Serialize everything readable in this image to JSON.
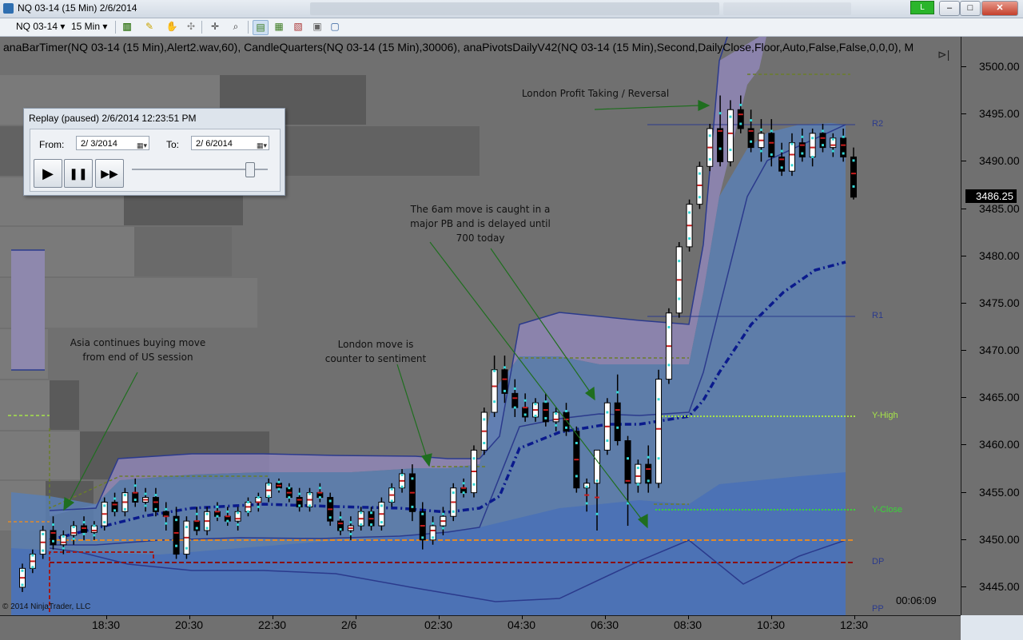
{
  "window": {
    "title": "NQ 03-14 (15 Min)  2/6/2014",
    "live_label": "L",
    "minimize": "–",
    "maximize": "□",
    "close": "✕"
  },
  "toolbar": {
    "instrument": "NQ 03-14",
    "interval": "15 Min"
  },
  "indicators_label": "anaBarTimer(NQ  03-14  (15  Min),Alert2.wav,60),  CandleQuarters(NQ  03-14  (15  Min),30006),  anaPivotsDailyV42(NQ  03-14  (15  Min),Second,DailyClose,Floor,Auto,False,False,0,0,0),  M",
  "replay": {
    "title": "Replay (paused) 2/6/2014 12:23:51 PM",
    "from_label": "From:",
    "from_value": "2/  3/2014",
    "to_label": "To:",
    "to_value": "2/  6/2014",
    "play": "▶",
    "pause": "❚❚",
    "forward": "▶▶",
    "speed_fraction": 0.89
  },
  "annotations": {
    "asia": [
      "Asia continues buying move",
      "from end of US session"
    ],
    "london": [
      "London move is",
      "counter to sentiment"
    ],
    "six_am": [
      "The 6am move is caught in a",
      "major PB and is delayed until",
      "700 today"
    ],
    "profit": [
      "London Profit Taking / Reversal"
    ]
  },
  "pivot_labels": {
    "r2": "R2",
    "r1": "R1",
    "y_high": "Y-High",
    "y_close": "Y-Close",
    "dp": "DP",
    "pp": "PP"
  },
  "colors": {
    "r_level": "#2b3a8c",
    "y_level": "#a6e34a",
    "dp": "#2b3a8c",
    "background": "#707070"
  },
  "current_price": "3486.25",
  "bar_timer": "00:06:09",
  "copyright": "© 2014 NinjaTrader, LLC",
  "chart_data": {
    "type": "candlestick",
    "y_axis": {
      "min": 3443,
      "max": 3501,
      "ticks": [
        "3500.00",
        "3495.00",
        "3490.00",
        "3485.00",
        "3480.00",
        "3475.00",
        "3470.00",
        "3465.00",
        "3460.00",
        "3455.00",
        "3450.00",
        "3445.00"
      ]
    },
    "x_axis": {
      "ticks": [
        "18:30",
        "20:30",
        "22:30",
        "2/6",
        "02:30",
        "04:30",
        "06:30",
        "08:30",
        "10:30",
        "12:30"
      ]
    },
    "levels": {
      "R2": 3494.0,
      "R1": 3473.8,
      "Y-High": 3463.3,
      "Y-Close": 3453.3,
      "DP": 3447.8
    },
    "candles": [
      [
        3445.0,
        3447.5,
        3444.5,
        3447.0
      ],
      [
        3447.0,
        3449.0,
        3446.5,
        3448.5
      ],
      [
        3448.5,
        3451.5,
        3448.0,
        3451.0
      ],
      [
        3451.0,
        3452.5,
        3449.0,
        3449.5
      ],
      [
        3449.5,
        3451.0,
        3448.5,
        3450.5
      ],
      [
        3450.5,
        3452.0,
        3449.5,
        3451.5
      ],
      [
        3451.5,
        3452.5,
        3450.0,
        3450.8
      ],
      [
        3450.8,
        3452.0,
        3450.0,
        3451.5
      ],
      [
        3451.5,
        3454.5,
        3451.0,
        3454.0
      ],
      [
        3454.0,
        3455.0,
        3452.5,
        3453.0
      ],
      [
        3453.0,
        3455.5,
        3452.5,
        3455.0
      ],
      [
        3455.0,
        3456.5,
        3453.5,
        3454.0
      ],
      [
        3454.0,
        3455.5,
        3453.0,
        3454.5
      ],
      [
        3454.5,
        3455.5,
        3452.5,
        3453.0
      ],
      [
        3453.0,
        3454.0,
        3451.0,
        3452.5
      ],
      [
        3452.5,
        3453.5,
        3448.0,
        3448.5
      ],
      [
        3448.5,
        3452.5,
        3448.0,
        3452.0
      ],
      [
        3452.0,
        3453.5,
        3450.5,
        3451.0
      ],
      [
        3451.0,
        3453.5,
        3450.5,
        3453.0
      ],
      [
        3453.0,
        3454.0,
        3452.0,
        3452.5
      ],
      [
        3452.5,
        3453.5,
        3451.5,
        3452.0
      ],
      [
        3452.0,
        3453.5,
        3451.0,
        3453.0
      ],
      [
        3453.0,
        3454.5,
        3452.5,
        3454.0
      ],
      [
        3454.0,
        3455.0,
        3453.0,
        3454.5
      ],
      [
        3454.5,
        3456.5,
        3454.0,
        3456.0
      ],
      [
        3456.0,
        3456.5,
        3455.0,
        3455.5
      ],
      [
        3455.5,
        3456.0,
        3454.0,
        3454.5
      ],
      [
        3454.5,
        3455.5,
        3453.0,
        3453.5
      ],
      [
        3453.5,
        3455.5,
        3453.0,
        3455.0
      ],
      [
        3455.0,
        3456.0,
        3454.0,
        3454.5
      ],
      [
        3454.5,
        3455.0,
        3451.5,
        3452.0
      ],
      [
        3452.0,
        3453.0,
        3450.5,
        3451.0
      ],
      [
        3451.0,
        3452.5,
        3450.0,
        3451.5
      ],
      [
        3451.5,
        3453.5,
        3451.0,
        3453.0
      ],
      [
        3453.0,
        3453.5,
        3451.0,
        3451.5
      ],
      [
        3451.5,
        3454.5,
        3451.0,
        3454.0
      ],
      [
        3454.0,
        3456.0,
        3453.5,
        3455.5
      ],
      [
        3455.5,
        3457.5,
        3455.0,
        3457.0
      ],
      [
        3457.0,
        3458.0,
        3452.0,
        3453.0
      ],
      [
        3453.0,
        3454.0,
        3449.0,
        3450.0
      ],
      [
        3450.0,
        3452.5,
        3449.5,
        3451.5
      ],
      [
        3451.5,
        3453.5,
        3450.5,
        3452.5
      ],
      [
        3452.5,
        3456.0,
        3452.0,
        3455.5
      ],
      [
        3455.5,
        3456.5,
        3454.5,
        3455.0
      ],
      [
        3455.0,
        3460.0,
        3454.5,
        3459.5
      ],
      [
        3459.5,
        3464.0,
        3459.0,
        3463.5
      ],
      [
        3463.5,
        3469.5,
        3463.0,
        3468.0
      ],
      [
        3468.0,
        3469.5,
        3464.5,
        3465.5
      ],
      [
        3465.5,
        3467.0,
        3463.0,
        3464.0
      ],
      [
        3464.0,
        3465.5,
        3462.5,
        3463.0
      ],
      [
        3463.0,
        3465.0,
        3462.5,
        3464.5
      ],
      [
        3464.5,
        3465.5,
        3462.0,
        3462.5
      ],
      [
        3462.5,
        3464.0,
        3461.5,
        3463.5
      ],
      [
        3463.5,
        3464.5,
        3461.0,
        3461.5
      ],
      [
        3461.5,
        3462.0,
        3455.0,
        3455.5
      ],
      [
        3455.5,
        3456.5,
        3453.0,
        3456.0
      ],
      [
        3456.0,
        3458.0,
        3451.0,
        3459.5
      ],
      [
        3459.5,
        3465.0,
        3459.0,
        3464.5
      ],
      [
        3464.5,
        3467.5,
        3460.0,
        3460.5
      ],
      [
        3460.5,
        3461.0,
        3451.5,
        3456.0
      ],
      [
        3456.0,
        3458.5,
        3455.0,
        3458.0
      ],
      [
        3458.0,
        3460.0,
        3455.0,
        3456.0
      ],
      [
        3456.0,
        3468.0,
        3455.5,
        3467.0
      ],
      [
        3467.0,
        3474.5,
        3466.5,
        3474.0
      ],
      [
        3474.0,
        3481.5,
        3473.5,
        3481.0
      ],
      [
        3481.0,
        3486.0,
        3480.5,
        3485.5
      ],
      [
        3485.5,
        3490.0,
        3485.0,
        3489.5
      ],
      [
        3489.5,
        3494.0,
        3489.0,
        3493.5
      ],
      [
        3493.5,
        3497.0,
        3489.5,
        3490.0
      ],
      [
        3490.0,
        3496.5,
        3489.5,
        3495.5
      ],
      [
        3495.5,
        3497.0,
        3493.0,
        3493.5
      ],
      [
        3493.5,
        3495.5,
        3491.0,
        3491.5
      ],
      [
        3491.5,
        3494.5,
        3490.0,
        3493.0
      ],
      [
        3493.0,
        3494.5,
        3489.5,
        3490.5
      ],
      [
        3490.5,
        3492.0,
        3488.5,
        3489.0
      ],
      [
        3489.0,
        3493.0,
        3488.5,
        3492.0
      ],
      [
        3492.0,
        3493.5,
        3490.0,
        3490.5
      ],
      [
        3490.5,
        3493.5,
        3489.5,
        3493.0
      ],
      [
        3493.0,
        3494.0,
        3491.0,
        3491.5
      ],
      [
        3491.5,
        3493.0,
        3490.5,
        3492.5
      ],
      [
        3492.5,
        3493.5,
        3490.0,
        3490.5
      ],
      [
        3490.5,
        3491.5,
        3486.0,
        3486.25
      ]
    ]
  }
}
